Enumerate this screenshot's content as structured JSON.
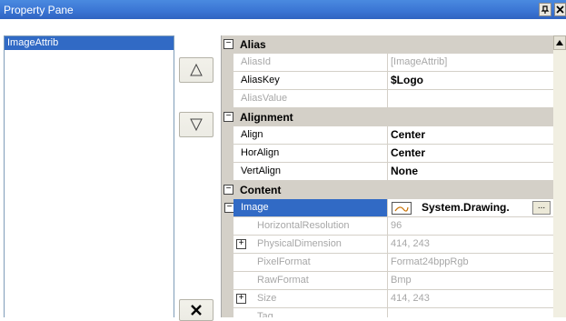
{
  "window": {
    "title": "Property Pane",
    "pin_glyph": "⭢",
    "close_glyph": "✕"
  },
  "list": {
    "items": [
      "ImageAttrib"
    ]
  },
  "buttons": {
    "up_icon": "triangle-up-icon",
    "down_icon": "triangle-down-icon",
    "delete_icon": "x-icon"
  },
  "grid": {
    "alias": {
      "label": "Alias",
      "alias_id": {
        "name": "AliasId",
        "value": "[ImageAttrib]"
      },
      "alias_key": {
        "name": "AliasKey",
        "value": "$Logo"
      },
      "alias_value": {
        "name": "AliasValue",
        "value": ""
      }
    },
    "alignment": {
      "label": "Alignment",
      "align": {
        "name": "Align",
        "value": "Center"
      },
      "hor_align": {
        "name": "HorAlign",
        "value": "Center"
      },
      "vert_align": {
        "name": "VertAlign",
        "value": "None"
      }
    },
    "content": {
      "label": "Content",
      "image": {
        "name": "Image",
        "value": "System.Drawing.",
        "button": "..."
      },
      "horizontal_resolution": {
        "name": "HorizontalResolution",
        "value": "96"
      },
      "physical_dimension": {
        "name": "PhysicalDimension",
        "value": "414, 243"
      },
      "pixel_format": {
        "name": "PixelFormat",
        "value": "Format24bppRgb"
      },
      "raw_format": {
        "name": "RawFormat",
        "value": "Bmp"
      },
      "size": {
        "name": "Size",
        "value": "414, 243"
      },
      "tag": {
        "name": "Tag",
        "value": ""
      }
    },
    "minus": "−",
    "plus": "+"
  }
}
